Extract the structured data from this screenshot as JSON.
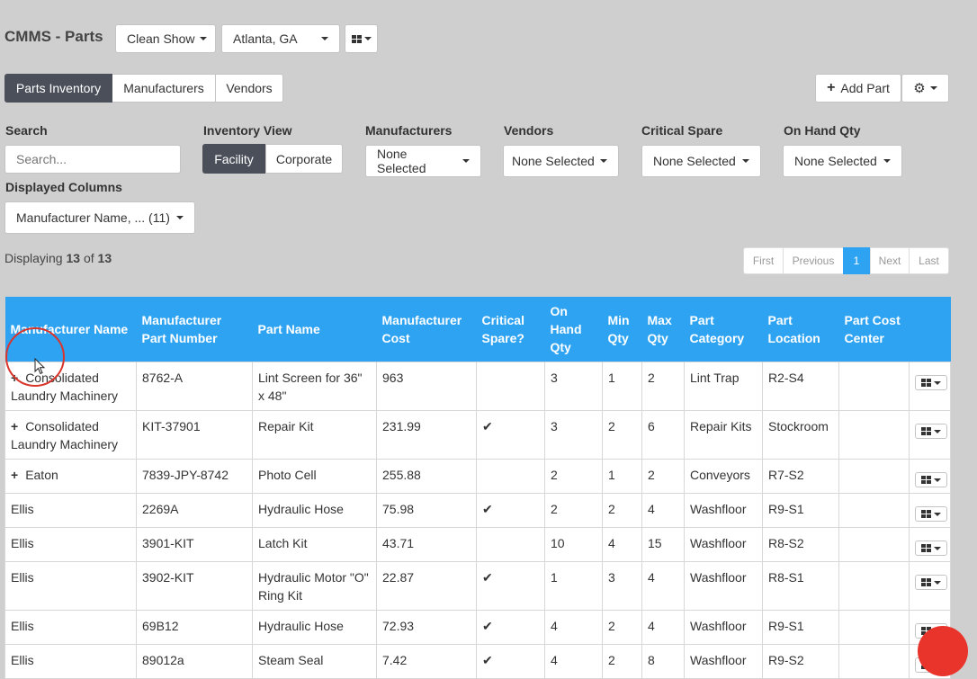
{
  "header": {
    "title": "CMMS - Parts",
    "clean_show": "Clean Show",
    "location": "Atlanta, GA"
  },
  "tabs": [
    "Parts Inventory",
    "Manufacturers",
    "Vendors"
  ],
  "actions": {
    "add_part": "Add Part"
  },
  "filters": {
    "search_label": "Search",
    "search_placeholder": "Search...",
    "inventory_view_label": "Inventory View",
    "inventory_views": [
      "Facility",
      "Corporate"
    ],
    "manufacturers_label": "Manufacturers",
    "manufacturers_value": "None Selected",
    "vendors_label": "Vendors",
    "vendors_value": "None Selected",
    "critical_label": "Critical Spare",
    "critical_value": "None Selected",
    "onhand_label": "On Hand Qty",
    "onhand_value": "None Selected",
    "columns_label": "Displayed Columns",
    "columns_value": "Manufacturer Name, ... (11)"
  },
  "display": {
    "prefix": "Displaying",
    "shown": "13",
    "of": "of",
    "total": "13"
  },
  "pagination": {
    "first": "First",
    "previous": "Previous",
    "current": "1",
    "next": "Next",
    "last": "Last"
  },
  "table": {
    "columns": [
      "Manufacturer Name",
      "Manufacturer Part Number",
      "Part Name",
      "Manufacturer Cost",
      "Critical Spare?",
      "On Hand Qty",
      "Min Qty",
      "Max Qty",
      "Part Category",
      "Part Location",
      "Part Cost Center"
    ],
    "rows": [
      {
        "expand": true,
        "manufacturer": "Consolidated Laundry Machinery",
        "mpn": "8762-A",
        "part": "Lint Screen for 36\" x 48\"",
        "cost": "963",
        "critical": false,
        "onhand": "3",
        "min": "1",
        "max": "2",
        "category": "Lint Trap",
        "location": "R2-S4",
        "center": ""
      },
      {
        "expand": true,
        "manufacturer": "Consolidated Laundry Machinery",
        "mpn": "KIT-37901",
        "part": "Repair Kit",
        "cost": "231.99",
        "critical": true,
        "onhand": "3",
        "min": "2",
        "max": "6",
        "category": "Repair Kits",
        "location": "Stockroom",
        "center": ""
      },
      {
        "expand": true,
        "manufacturer": "Eaton",
        "mpn": "7839-JPY-8742",
        "part": "Photo Cell",
        "cost": "255.88",
        "critical": false,
        "onhand": "2",
        "min": "1",
        "max": "2",
        "category": "Conveyors",
        "location": "R7-S2",
        "center": ""
      },
      {
        "expand": false,
        "manufacturer": "Ellis",
        "mpn": "2269A",
        "part": "Hydraulic Hose",
        "cost": "75.98",
        "critical": true,
        "onhand": "2",
        "min": "2",
        "max": "4",
        "category": "Washfloor",
        "location": "R9-S1",
        "center": ""
      },
      {
        "expand": false,
        "manufacturer": "Ellis",
        "mpn": "3901-KIT",
        "part": "Latch Kit",
        "cost": "43.71",
        "critical": false,
        "onhand": "10",
        "min": "4",
        "max": "15",
        "category": "Washfloor",
        "location": "R8-S2",
        "center": ""
      },
      {
        "expand": false,
        "manufacturer": "Ellis",
        "mpn": "3902-KIT",
        "part": "Hydraulic Motor \"O\" Ring Kit",
        "cost": "22.87",
        "critical": true,
        "onhand": "1",
        "min": "3",
        "max": "4",
        "category": "Washfloor",
        "location": "R8-S1",
        "center": ""
      },
      {
        "expand": false,
        "manufacturer": "Ellis",
        "mpn": "69B12",
        "part": "Hydraulic Hose",
        "cost": "72.93",
        "critical": true,
        "onhand": "4",
        "min": "2",
        "max": "4",
        "category": "Washfloor",
        "location": "R9-S1",
        "center": ""
      },
      {
        "expand": false,
        "manufacturer": "Ellis",
        "mpn": "89012a",
        "part": "Steam Seal",
        "cost": "7.42",
        "critical": true,
        "onhand": "4",
        "min": "2",
        "max": "8",
        "category": "Washfloor",
        "location": "R9-S2",
        "center": ""
      }
    ]
  },
  "colors": {
    "header_blue": "#2ea3f2",
    "active_dark": "#4a4f5a",
    "cursor_ring": "#d9352b"
  }
}
